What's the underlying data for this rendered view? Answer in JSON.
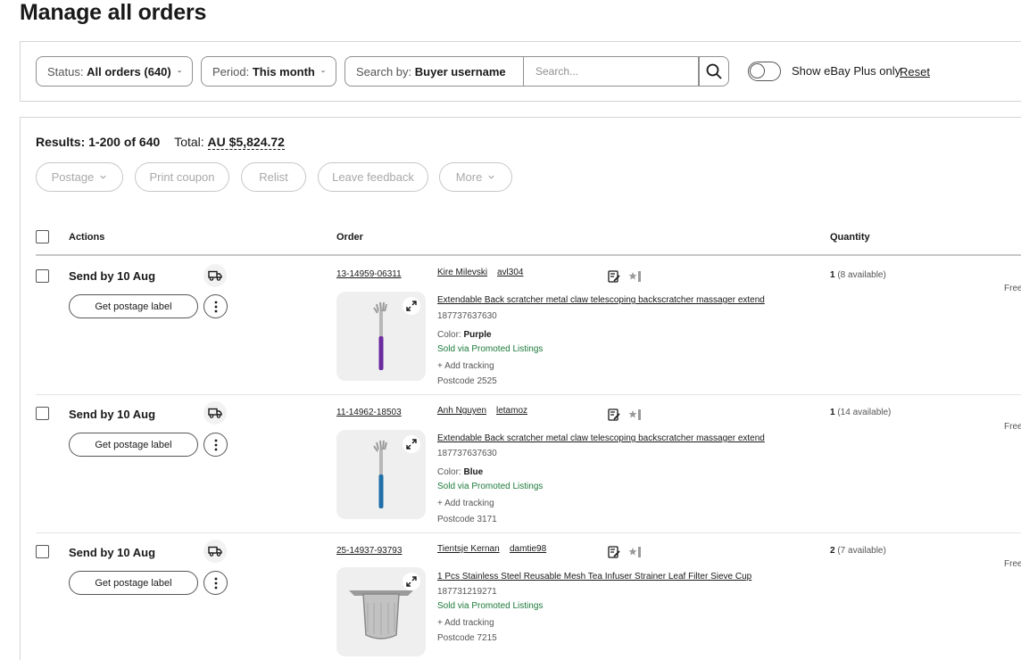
{
  "page": {
    "title": "Manage all orders"
  },
  "filters": {
    "status_prefix": "Status:",
    "status_value": "All orders (640)",
    "period_prefix": "Period:",
    "period_value": "This month",
    "search_by_prefix": "Search by:",
    "search_by_value": "Buyer username",
    "search_placeholder": "Search...",
    "plus_toggle_label": "Show eBay Plus only",
    "reset_label": "Reset"
  },
  "results": {
    "label": "Results:",
    "range": "1-200 of 640",
    "total_label": "Total:",
    "total_value": "AU $5,824.72"
  },
  "bulk_actions": {
    "postage": "Postage",
    "print_coupon": "Print coupon",
    "relist": "Relist",
    "leave_feedback": "Leave feedback",
    "more": "More"
  },
  "table": {
    "columns": {
      "actions": "Actions",
      "order": "Order",
      "quantity": "Quantity"
    },
    "rows": [
      {
        "send_by": "Send by 10 Aug",
        "postage_button": "Get postage label",
        "order_number": "13-14959-06311",
        "buyer_name": "Kire Milevski",
        "buyer_username": "avl304",
        "title": "Extendable Back scratcher metal claw telescoping backscratcher massager extend",
        "item_id": "187737637630",
        "variation_label": "Color:",
        "variation_value": "Purple",
        "promo": "Sold via Promoted Listings",
        "tracking": "+ Add tracking",
        "postcode": "Postcode 2525",
        "qty": "1",
        "available": "(8 available)",
        "shipping": "Free"
      },
      {
        "send_by": "Send by 10 Aug",
        "postage_button": "Get postage label",
        "order_number": "11-14962-18503",
        "buyer_name": "Anh Nguyen",
        "buyer_username": "letamoz",
        "title": "Extendable Back scratcher metal claw telescoping backscratcher massager extend",
        "item_id": "187737637630",
        "variation_label": "Color:",
        "variation_value": "Blue",
        "promo": "Sold via Promoted Listings",
        "tracking": "+ Add tracking",
        "postcode": "Postcode 3171",
        "qty": "1",
        "available": "(14 available)",
        "shipping": "Free"
      },
      {
        "send_by": "Send by 10 Aug",
        "postage_button": "Get postage label",
        "order_number": "25-14937-93793",
        "buyer_name": "Tientsje Kernan",
        "buyer_username": "damtie98",
        "title": "1 Pcs Stainless Steel Reusable Mesh Tea Infuser Strainer Leaf Filter Sieve Cup",
        "item_id": "187731219271",
        "promo": "Sold via Promoted Listings",
        "tracking": "+ Add tracking",
        "postcode": "Postcode 7215",
        "qty": "2",
        "available": "(7 available)",
        "shipping": "Free"
      }
    ]
  },
  "colors": {
    "text": "#191919",
    "muted": "#555555",
    "promo_green": "#1d7a3b",
    "border": "#8f8f8f",
    "purple_handle": "#6b2aa0",
    "blue_handle": "#1f6fa8"
  },
  "icons": [
    "chevron-down-icon",
    "search-icon",
    "truck-icon",
    "more-vertical-icon",
    "expand-icon",
    "note-icon",
    "star-icon"
  ]
}
